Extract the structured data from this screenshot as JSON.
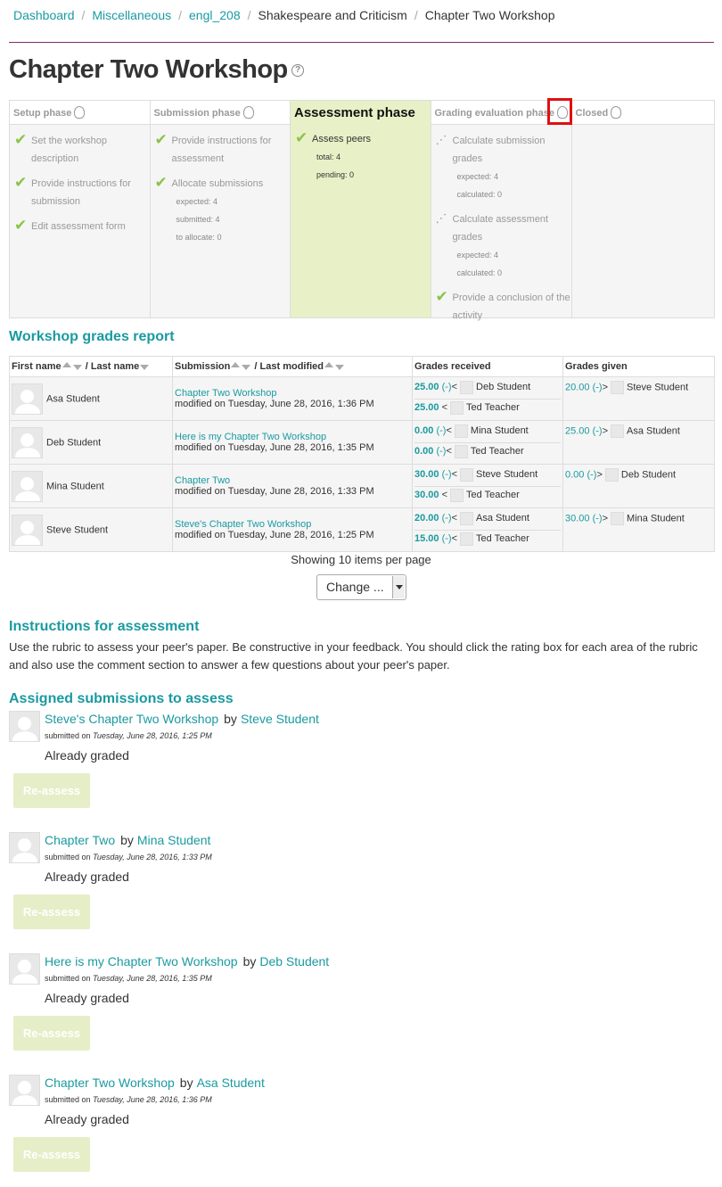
{
  "breadcrumb": [
    "Dashboard",
    "Miscellaneous",
    "engl_208",
    "Shakespeare and Criticism",
    "Chapter Two Workshop"
  ],
  "page_title": "Chapter Two Workshop",
  "phases": {
    "setup": {
      "title": "Setup phase",
      "tasks": [
        "Set the workshop description",
        "Provide instructions for submission",
        "Edit assessment form"
      ]
    },
    "submission": {
      "title": "Submission phase",
      "tasks": [
        "Provide instructions for assessment",
        "Allocate submissions"
      ],
      "info": [
        "expected: 4",
        "submitted: 4",
        "to allocate: 0"
      ]
    },
    "assessment": {
      "title": "Assessment phase",
      "task": "Assess peers",
      "info": [
        "total: 4",
        "pending: 0"
      ]
    },
    "grading": {
      "title": "Grading evaluation phase",
      "task1": "Calculate submission grades",
      "info1": [
        "expected: 4",
        "calculated: 0"
      ],
      "task2": "Calculate assessment grades",
      "info2": [
        "expected: 4",
        "calculated: 0"
      ],
      "task3": "Provide a conclusion of the activity"
    },
    "closed": {
      "title": "Closed"
    }
  },
  "report": {
    "heading": "Workshop grades report",
    "headers": {
      "first_name": "First name",
      "last_name": "/ Last name",
      "submission": "Submission",
      "last_modified": "/ Last modified",
      "received": "Grades received",
      "given": "Grades given"
    },
    "rows": [
      {
        "name": "Asa Student",
        "sub_title": "Chapter Two Workshop",
        "modified": "modified on Tuesday, June 28, 2016, 1:36 PM",
        "received": [
          {
            "grade": "25.00",
            "paren": "(-)",
            "arrow": "<",
            "who": "Deb Student"
          },
          {
            "grade": "25.00",
            "paren": "",
            "arrow": "<",
            "who": "Ted Teacher"
          }
        ],
        "given": {
          "grade": "20.00",
          "paren": "(-)",
          "arrow": ">",
          "who": "Steve Student"
        }
      },
      {
        "name": "Deb Student",
        "sub_title": "Here is my Chapter Two Workshop",
        "modified": "modified on Tuesday, June 28, 2016, 1:35 PM",
        "received": [
          {
            "grade": "0.00",
            "paren": "(-)",
            "arrow": "<",
            "who": "Mina Student"
          },
          {
            "grade": "0.00",
            "paren": "(-)",
            "arrow": "<",
            "who": "Ted Teacher"
          }
        ],
        "given": {
          "grade": "25.00",
          "paren": "(-)",
          "arrow": ">",
          "who": "Asa Student"
        }
      },
      {
        "name": "Mina Student",
        "sub_title": "Chapter Two",
        "modified": "modified on Tuesday, June 28, 2016, 1:33 PM",
        "received": [
          {
            "grade": "30.00",
            "paren": "(-)",
            "arrow": "<",
            "who": "Steve Student"
          },
          {
            "grade": "30.00",
            "paren": "",
            "arrow": "<",
            "who": "Ted Teacher"
          }
        ],
        "given": {
          "grade": "0.00",
          "paren": "(-)",
          "arrow": ">",
          "who": "Deb Student"
        }
      },
      {
        "name": "Steve Student",
        "sub_title": "Steve's Chapter Two Workshop",
        "modified": "modified on Tuesday, June 28, 2016, 1:25 PM",
        "received": [
          {
            "grade": "20.00",
            "paren": "(-)",
            "arrow": "<",
            "who": "Asa Student"
          },
          {
            "grade": "15.00",
            "paren": "(-)",
            "arrow": "<",
            "who": "Ted Teacher"
          }
        ],
        "given": {
          "grade": "30.00",
          "paren": "(-)",
          "arrow": ">",
          "who": "Mina Student"
        }
      }
    ]
  },
  "paging": {
    "text": "Showing 10 items per page",
    "select_value": "Change ..."
  },
  "instructions": {
    "heading": "Instructions for assessment",
    "text": "Use the rubric to assess your peer's paper. Be constructive in your feedback. You should click the rating box for each area of the rubric and also use the comment section to answer a few questions about your peer's paper."
  },
  "assigned": {
    "heading": "Assigned submissions to assess",
    "by_label": "by",
    "submitted_label": "submitted on",
    "items": [
      {
        "title": "Steve's Chapter Two Workshop",
        "author": "Steve Student",
        "date": "Tuesday, June 28, 2016, 1:25 PM",
        "status": "Already graded",
        "button": "Re-assess"
      },
      {
        "title": "Chapter Two",
        "author": "Mina Student",
        "date": "Tuesday, June 28, 2016, 1:33 PM",
        "status": "Already graded",
        "button": "Re-assess"
      },
      {
        "title": "Here is my Chapter Two Workshop",
        "author": "Deb Student",
        "date": "Tuesday, June 28, 2016, 1:35 PM",
        "status": "Already graded",
        "button": "Re-assess"
      },
      {
        "title": "Chapter Two Workshop",
        "author": "Asa Student",
        "date": "Tuesday, June 28, 2016, 1:36 PM",
        "status": "Already graded",
        "button": "Re-assess"
      }
    ]
  },
  "colors": {
    "link": "#1a9aa0",
    "active_phase": "#e8f0c7",
    "check": "#8bc34a",
    "highlight": "#e01010",
    "divider": "#8a2a6b"
  }
}
